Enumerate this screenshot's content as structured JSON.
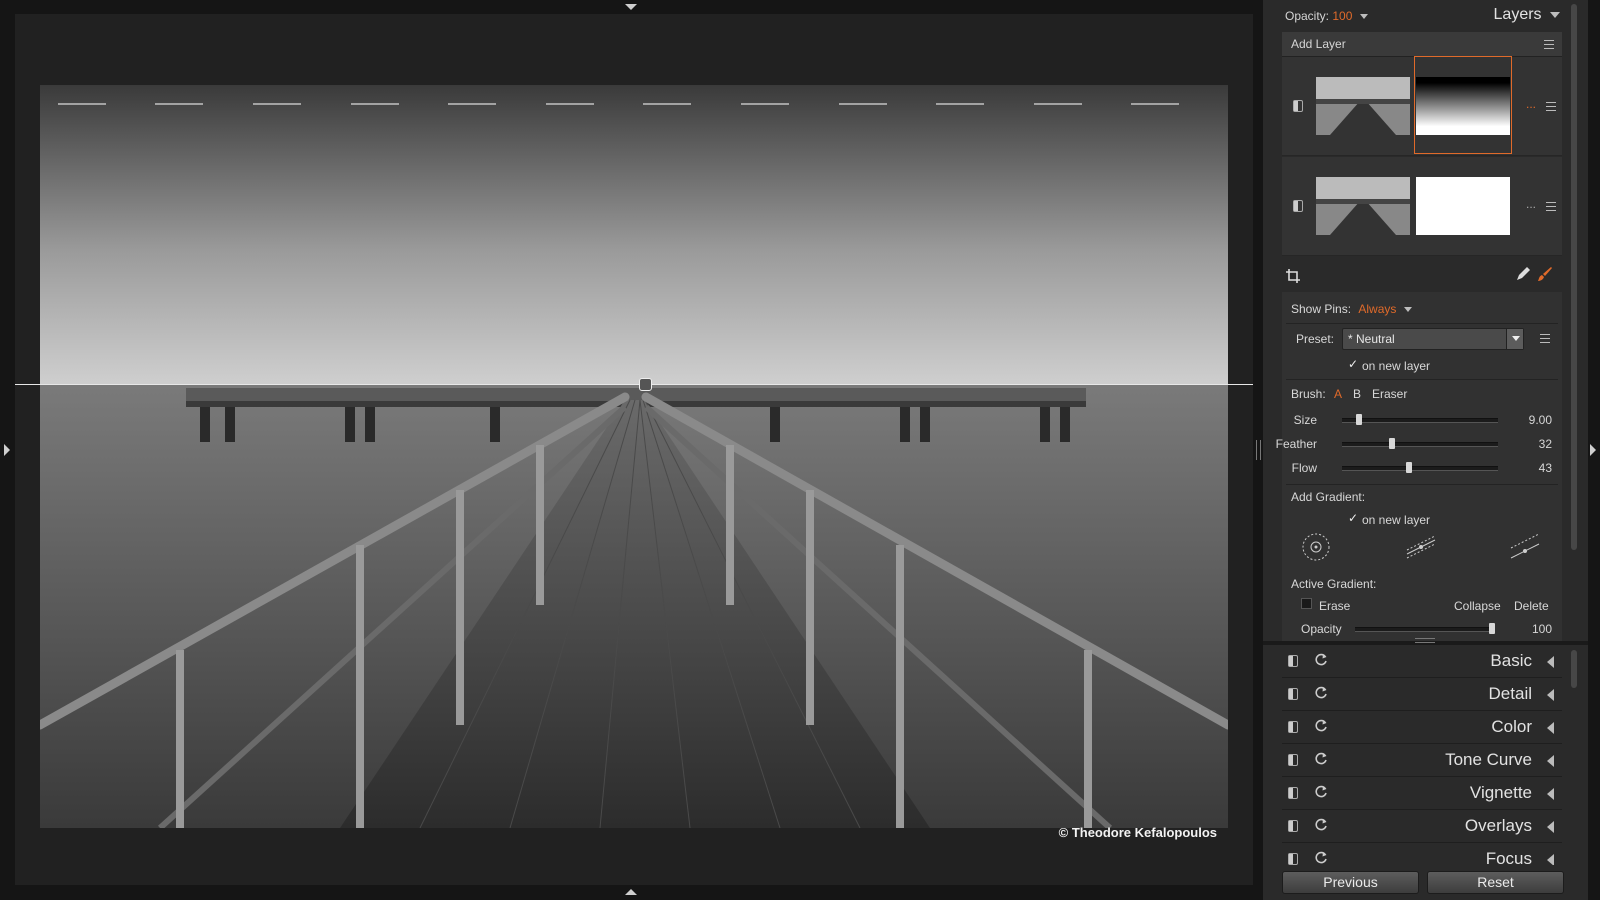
{
  "canvas": {
    "credit": "© Theodore Kefalopoulos"
  },
  "layers_panel": {
    "opacity_label": "Opacity:",
    "opacity_value": "100",
    "title": "Layers",
    "add_layer": "Add Layer",
    "layer_more": "..."
  },
  "mask_tools": {
    "show_pins_label": "Show Pins:",
    "show_pins_value": "Always",
    "preset_label": "Preset:",
    "preset_value": "* Neutral",
    "on_new_layer_1": "on new layer",
    "brush_label": "Brush:",
    "brush_a": "A",
    "brush_b": "B",
    "brush_eraser": "Eraser",
    "size_label": "Size",
    "size_value": "9.00",
    "size_fraction": 0.11,
    "feather_label": "Feather",
    "feather_value": "32",
    "feather_fraction": 0.32,
    "flow_label": "Flow",
    "flow_value": "43",
    "flow_fraction": 0.43,
    "add_gradient_label": "Add Gradient:",
    "on_new_layer_2": "on new layer",
    "active_gradient_label": "Active Gradient:",
    "erase_label": "Erase",
    "collapse_label": "Collapse",
    "delete_label": "Delete",
    "opacity_label": "Opacity",
    "opacity_value": "100",
    "opacity_fraction": 1.0
  },
  "modules": [
    {
      "label": "Basic"
    },
    {
      "label": "Detail"
    },
    {
      "label": "Color"
    },
    {
      "label": "Tone Curve"
    },
    {
      "label": "Vignette"
    },
    {
      "label": "Overlays"
    },
    {
      "label": "Focus"
    }
  ],
  "footer": {
    "previous": "Previous",
    "reset": "Reset"
  },
  "colors": {
    "accent": "#e06a2a",
    "panel": "#2a2a2a",
    "canvas": "#212121"
  }
}
